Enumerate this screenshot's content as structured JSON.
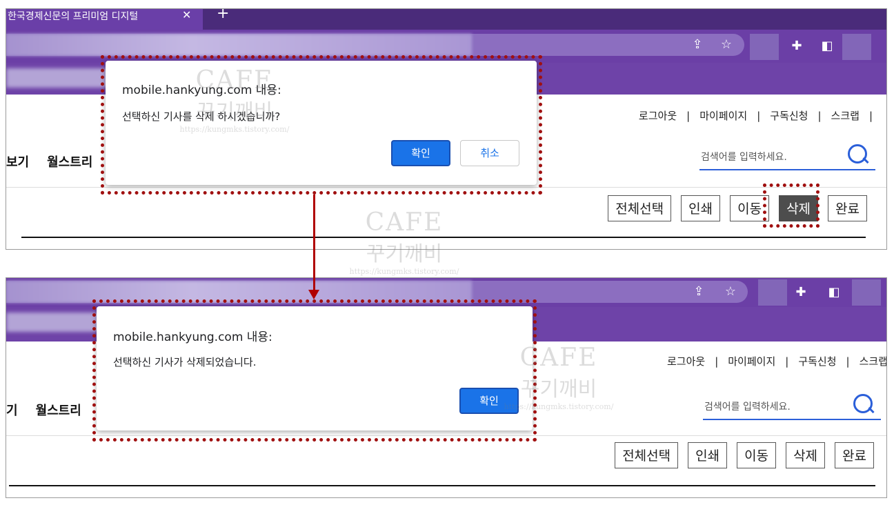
{
  "browser": {
    "tab_title": "한국경제신문의 프리미엄 디지털",
    "tab_close": "✕",
    "new_tab": "+",
    "icons": [
      "share-icon",
      "star-icon",
      "extensions-icon",
      "sidebar-icon"
    ]
  },
  "site": {
    "top_links": [
      "로그아웃",
      "마이페이지",
      "구독신청",
      "스크랩"
    ],
    "separator": "|",
    "gnb_before": [
      "보기",
      "월스트리"
    ],
    "gnb_after": [
      "기",
      "월스트리"
    ],
    "search_placeholder": "검색어를 입력하세요.",
    "buttons": [
      "전체선택",
      "인쇄",
      "이동",
      "삭제",
      "완료"
    ]
  },
  "dialog_confirm": {
    "title": "mobile.hankyung.com 내용:",
    "message": "선택하신 기사를 삭제 하시겠습니까?",
    "ok_label": "확인",
    "cancel_label": "취소"
  },
  "dialog_alert": {
    "title": "mobile.hankyung.com 내용:",
    "message": "선택하신 기사가 삭제되었습니다.",
    "ok_label": "확인"
  },
  "watermark": {
    "line1": "CAFE",
    "line2": "꾸기깨비",
    "line3": "https://kungmks.tistory.com/"
  },
  "colors": {
    "browser_purple": "#6b3fa6",
    "confirm_blue": "#1a73e8",
    "highlight_red": "#a01010",
    "active_button": "#4d4d4d"
  }
}
